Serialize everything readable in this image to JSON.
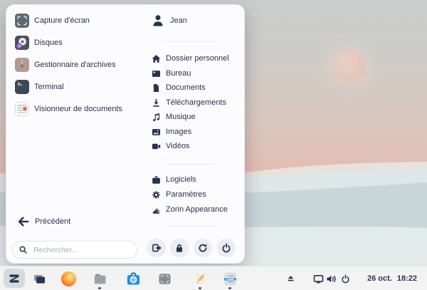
{
  "menu": {
    "apps": [
      {
        "label": "Capture d'écran",
        "icon": "screenshot-app-icon"
      },
      {
        "label": "Disques",
        "icon": "disks-app-icon"
      },
      {
        "label": "Gestionnaire d'archives",
        "icon": "archive-manager-app-icon"
      },
      {
        "label": "Terminal",
        "icon": "terminal-app-icon"
      },
      {
        "label": "Visionneur de documents",
        "icon": "document-viewer-app-icon"
      }
    ],
    "user": {
      "name": "Jean",
      "icon": "user-avatar-icon"
    },
    "places": [
      {
        "label": "Dossier personnel",
        "icon": "home-icon"
      },
      {
        "label": "Bureau",
        "icon": "desktop-icon"
      },
      {
        "label": "Documents",
        "icon": "document-icon"
      },
      {
        "label": "Téléchargements",
        "icon": "download-icon"
      },
      {
        "label": "Musique",
        "icon": "music-icon"
      },
      {
        "label": "Images",
        "icon": "image-icon"
      },
      {
        "label": "Vidéos",
        "icon": "video-icon"
      }
    ],
    "system": [
      {
        "label": "Logiciels",
        "icon": "software-store-icon"
      },
      {
        "label": "Paramètres",
        "icon": "settings-gear-icon"
      },
      {
        "label": "Zorin Appearance",
        "icon": "appearance-icon"
      }
    ],
    "back_label": "Précédent",
    "search_placeholder": "Rechercher...",
    "session_buttons": [
      "logout",
      "lock",
      "restart",
      "power"
    ]
  },
  "taskbar": {
    "launchers": [
      "zorin-menu",
      "workspaces",
      "firefox",
      "files",
      "software-store",
      "screenshot-tool",
      "text-editor",
      "tweaks"
    ],
    "tray": [
      "eject",
      "display",
      "volume",
      "power"
    ],
    "date": "26 oct.",
    "time": "18:22"
  },
  "colors": {
    "icon_navy": "#24334f",
    "badge_purple": "#7e41c8",
    "software_blue": "#1e8fe0",
    "accent_row_blue": "#2f9de8",
    "firefox_orange": "#ff8a1e",
    "sky_pink": "#eeb4aa",
    "panel_bg": "#fcfcfe"
  }
}
